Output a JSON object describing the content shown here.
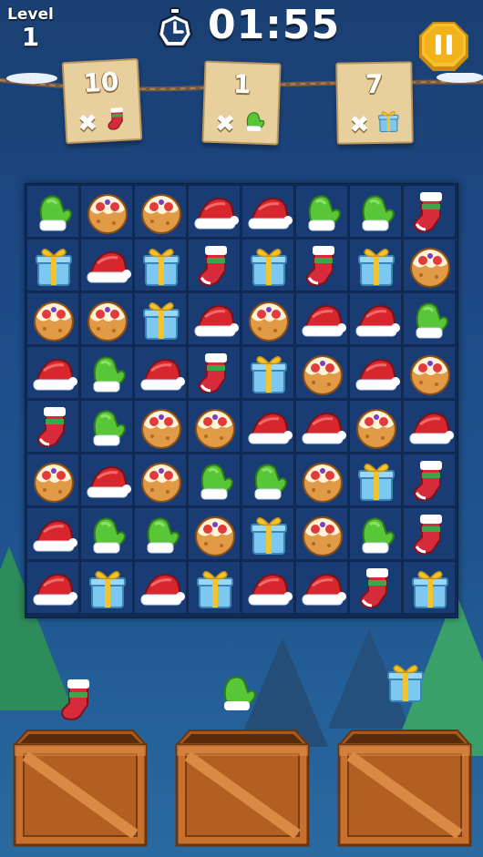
{
  "hud": {
    "level_label": "Level",
    "level_number": "1",
    "timer": "01:55"
  },
  "icons": {
    "timer": "stopwatch-icon",
    "pause": "pause-icon",
    "pieces": [
      "mitten",
      "cookie",
      "santa-hat",
      "stocking",
      "gift"
    ]
  },
  "goals": [
    {
      "count": "10",
      "times": "✖",
      "item": "stocking"
    },
    {
      "count": "1",
      "times": "✖",
      "item": "mitten"
    },
    {
      "count": "7",
      "times": "✖",
      "item": "gift"
    }
  ],
  "board": {
    "rows": 8,
    "cols": 8,
    "grid": [
      [
        "mitten",
        "cookie",
        "cookie",
        "hat",
        "hat",
        "mitten",
        "mitten",
        "stocking"
      ],
      [
        "gift",
        "hat",
        "gift",
        "stocking",
        "gift",
        "stocking",
        "gift",
        "cookie"
      ],
      [
        "cookie",
        "cookie",
        "gift",
        "hat",
        "cookie",
        "hat",
        "hat",
        "mitten"
      ],
      [
        "hat",
        "mitten",
        "hat",
        "stocking",
        "gift",
        "cookie",
        "hat",
        "cookie"
      ],
      [
        "stocking",
        "mitten",
        "cookie",
        "cookie",
        "hat",
        "hat",
        "cookie",
        "hat"
      ],
      [
        "cookie",
        "hat",
        "cookie",
        "mitten",
        "mitten",
        "cookie",
        "gift",
        "stocking"
      ],
      [
        "hat",
        "mitten",
        "mitten",
        "cookie",
        "gift",
        "cookie",
        "mitten",
        "stocking"
      ],
      [
        "hat",
        "gift",
        "hat",
        "gift",
        "hat",
        "hat",
        "stocking",
        "gift"
      ]
    ]
  },
  "crates": [
    {
      "item": "stocking"
    },
    {
      "item": "mitten"
    },
    {
      "item": "gift"
    }
  ],
  "colors": {
    "background": "#1d4a86",
    "board": "#112b57",
    "cell": "#1a3c74",
    "card": "#e8cf9e",
    "crate": "#c8702e",
    "pause": "#f2b21c"
  }
}
